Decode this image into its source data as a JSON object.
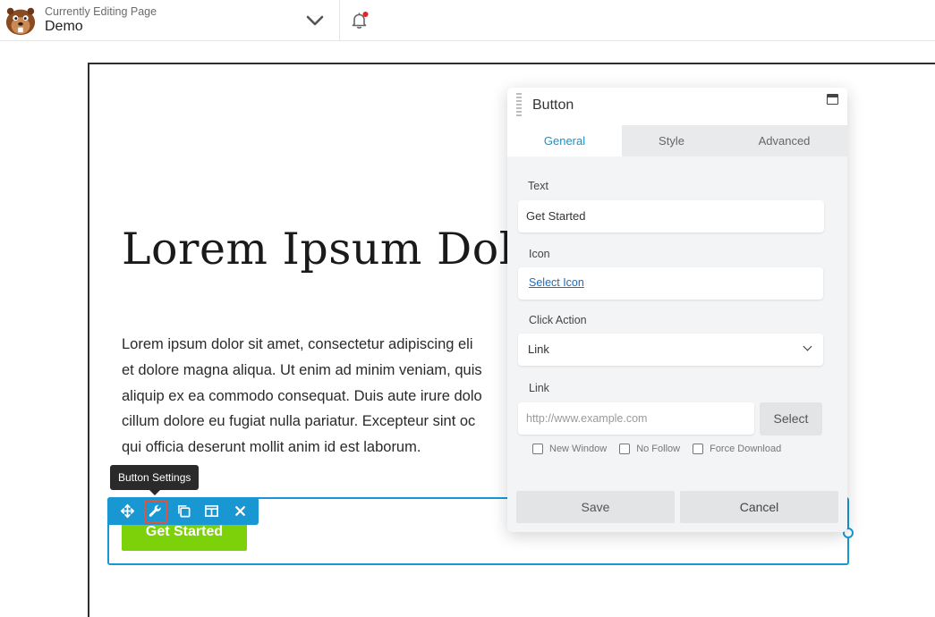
{
  "topbar": {
    "editing_label": "Currently Editing Page",
    "page_name": "Demo"
  },
  "page": {
    "title": "Lorem Ipsum Dolo",
    "body_lines": [
      "Lorem ipsum dolor sit amet, consectetur adipiscing eli",
      "et dolore magna aliqua. Ut enim ad minim veniam, quis",
      "aliquip ex ea commodo consequat. Duis aute irure dolo",
      "cillum dolore eu fugiat nulla pariatur. Excepteur sint oc",
      "qui officia deserunt mollit anim id est laborum."
    ],
    "button_text": "Get Started"
  },
  "tooltip": "Button Settings",
  "panel": {
    "title": "Button",
    "tabs": [
      "General",
      "Style",
      "Advanced"
    ],
    "text_label": "Text",
    "text_value": "Get Started",
    "icon_label": "Icon",
    "icon_link": "Select Icon",
    "click_action_label": "Click Action",
    "click_action_value": "Link",
    "link_label": "Link",
    "link_placeholder": "http://www.example.com",
    "select_button": "Select",
    "checkboxes": [
      "New Window",
      "No Follow",
      "Force Download"
    ],
    "save": "Save",
    "cancel": "Cancel"
  },
  "colors": {
    "accent": "#1897d2",
    "button_green": "#7cd10b",
    "notification_dot": "#e0242b"
  }
}
